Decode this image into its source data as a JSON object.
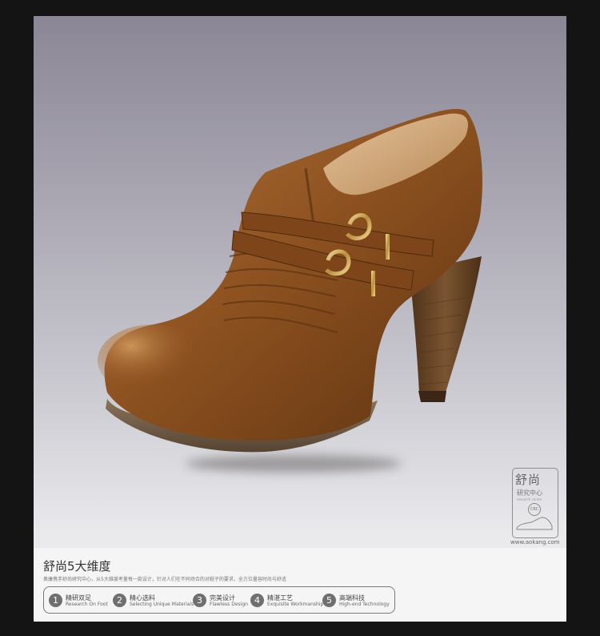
{
  "colors": {
    "frame": "#141414",
    "leather": "#8a4f1e",
    "sole": "#6e5a44",
    "heel": "#6a4726",
    "buckle": "#c9a55a",
    "badge": "#6f6f6f"
  },
  "stamp": {
    "title": "舒尚",
    "subtitle": "研究中心",
    "small": "research center",
    "circle": "CRC",
    "icon": "shoe-outline-icon",
    "url": "www.aokang.com"
  },
  "info": {
    "title": "舒尚5大维度",
    "description": "奥康携手舒尚研究中心，从5大维度考量每一款设计，针对人们在不同场合的对鞋子的要求，全方位量容时尚与舒适",
    "items": [
      {
        "num": "1",
        "cn": "精研双足",
        "en": "Research On Foot"
      },
      {
        "num": "2",
        "cn": "精心选料",
        "en": "Selecting Unique Materials"
      },
      {
        "num": "3",
        "cn": "完美设计",
        "en": "Flawless Design"
      },
      {
        "num": "4",
        "cn": "精湛工艺",
        "en": "Exquisite Workmanship"
      },
      {
        "num": "5",
        "cn": "高端科技",
        "en": "High-end Technology"
      }
    ]
  }
}
